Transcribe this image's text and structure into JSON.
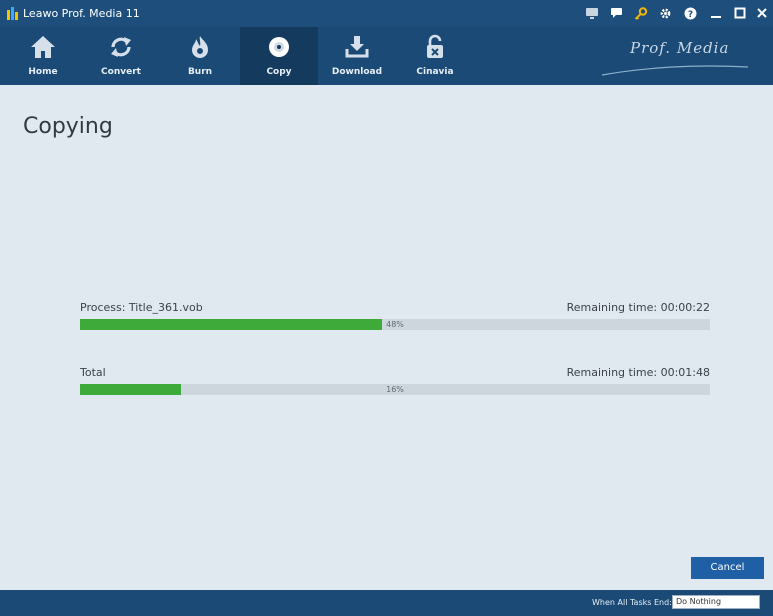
{
  "app": {
    "title": "Leawo Prof. Media 11"
  },
  "titlebar_icons": [
    "monitor-icon",
    "chat-icon",
    "key-icon",
    "gear-icon",
    "help-icon",
    "minimize-icon",
    "maximize-icon",
    "close-icon"
  ],
  "nav": {
    "items": [
      {
        "label": "Home",
        "icon": "home-icon"
      },
      {
        "label": "Convert",
        "icon": "convert-icon"
      },
      {
        "label": "Burn",
        "icon": "burn-icon"
      },
      {
        "label": "Copy",
        "icon": "disc-icon"
      },
      {
        "label": "Download",
        "icon": "download-icon"
      },
      {
        "label": "Cinavia",
        "icon": "unlock-icon"
      }
    ],
    "active": "Copy",
    "brand": "Prof. Media"
  },
  "main": {
    "title": "Copying",
    "process": {
      "label": "Process: Title_361.vob",
      "remaining": "Remaining time: 00:00:22",
      "percent": 48,
      "percent_text": "48%"
    },
    "total": {
      "label": "Total",
      "remaining": "Remaining time: 00:01:48",
      "percent": 16,
      "percent_text": "16%"
    }
  },
  "footer": {
    "cancel_label": "Cancel",
    "when_label": "When All Tasks End:",
    "when_value": "Do Nothing"
  },
  "colors": {
    "titlebar": "#1e4f7c",
    "navbar": "#1a4a75",
    "nav_active": "#143b5e",
    "progress_fill": "#3eaa3a",
    "progress_track": "#cdd6dc",
    "content_bg": "#dfe9ef",
    "button": "#1f5fa5"
  }
}
